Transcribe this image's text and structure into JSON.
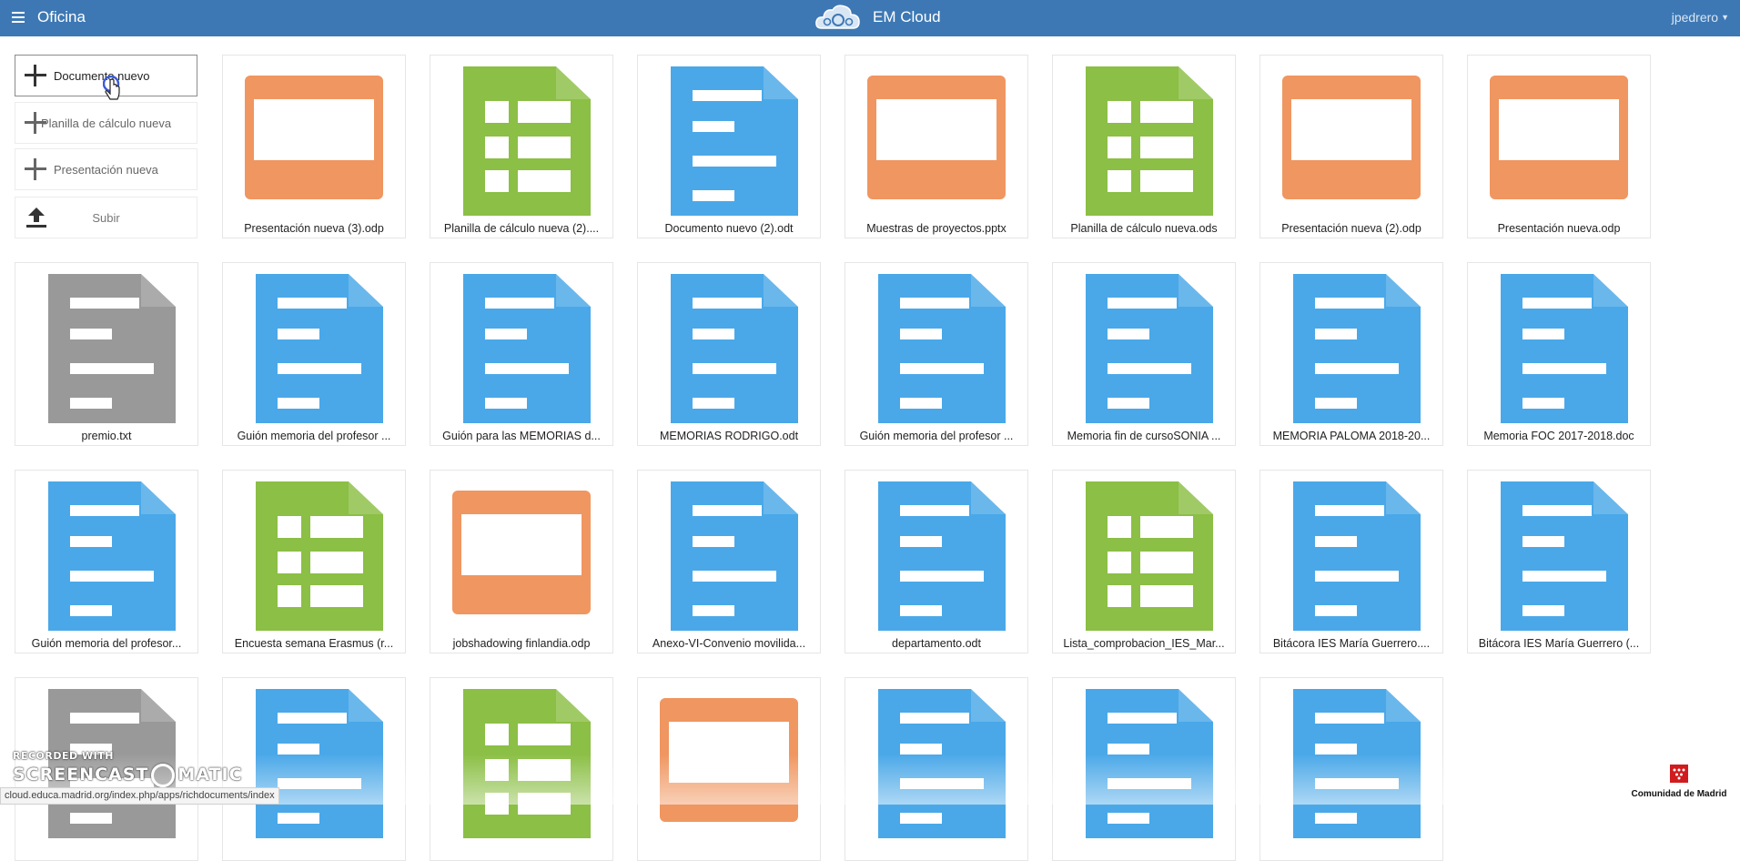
{
  "header": {
    "menu_icon": "hamburger-icon",
    "app_title": "Oficina",
    "brand_logo": "cloud-logo",
    "brand_name": "EM Cloud",
    "user": "jpedrero",
    "bg_color": "#3d78b4"
  },
  "sidebar": {
    "new_document": "Documento nuevo",
    "new_spreadsheet": "Planilla de cálculo nueva",
    "new_presentation": "Presentación nueva",
    "upload": "Subir",
    "upload_icon": "upload-icon"
  },
  "colors": {
    "presentation": "#f09660",
    "spreadsheet": "#8bbf45",
    "document": "#4aa8e8",
    "text": "#999999"
  },
  "files": [
    {
      "name": "Presentación nueva (3).odp",
      "type": "presentation"
    },
    {
      "name": "Planilla de cálculo nueva (2)....",
      "type": "spreadsheet"
    },
    {
      "name": "Documento nuevo (2).odt",
      "type": "document"
    },
    {
      "name": "Muestras de proyectos.pptx",
      "type": "presentation"
    },
    {
      "name": "Planilla de cálculo nueva.ods",
      "type": "spreadsheet"
    },
    {
      "name": "Presentación nueva (2).odp",
      "type": "presentation"
    },
    {
      "name": "Presentación nueva.odp",
      "type": "presentation"
    },
    {
      "name": "premio.txt",
      "type": "text"
    },
    {
      "name": "Guión memoria del profesor ...",
      "type": "document"
    },
    {
      "name": "Guión para las MEMORIAS d...",
      "type": "document"
    },
    {
      "name": "MEMORIAS RODRIGO.odt",
      "type": "document"
    },
    {
      "name": "Guión memoria del profesor ...",
      "type": "document"
    },
    {
      "name": "Memoria fin de cursoSONIA ...",
      "type": "document"
    },
    {
      "name": "MEMORIA PALOMA 2018-20...",
      "type": "document"
    },
    {
      "name": "Memoria FOC 2017-2018.doc",
      "type": "document"
    },
    {
      "name": "Guión memoria del profesor...",
      "type": "document"
    },
    {
      "name": "Encuesta semana Erasmus (r...",
      "type": "spreadsheet"
    },
    {
      "name": "jobshadowing finlandia.odp",
      "type": "presentation"
    },
    {
      "name": "Anexo-VI-Convenio movilida...",
      "type": "document"
    },
    {
      "name": "departamento.odt",
      "type": "document"
    },
    {
      "name": "Lista_comprobacion_IES_Mar...",
      "type": "spreadsheet"
    },
    {
      "name": "Bitácora IES María Guerrero....",
      "type": "document"
    },
    {
      "name": "Bitácora IES María Guerrero (...",
      "type": "document"
    },
    {
      "name": "",
      "type": "text"
    },
    {
      "name": "",
      "type": "document"
    },
    {
      "name": "",
      "type": "spreadsheet"
    },
    {
      "name": "",
      "type": "presentation"
    },
    {
      "name": "",
      "type": "document"
    },
    {
      "name": "",
      "type": "document"
    },
    {
      "name": "",
      "type": "document"
    }
  ],
  "watermark": {
    "line1": "RECORDED WITH",
    "line2a": "SCREENCAST",
    "line2b": "MATIC"
  },
  "status_url": "cloud.educa.madrid.org/index.php/apps/richdocuments/index",
  "footer_logo": "Comunidad de Madrid"
}
